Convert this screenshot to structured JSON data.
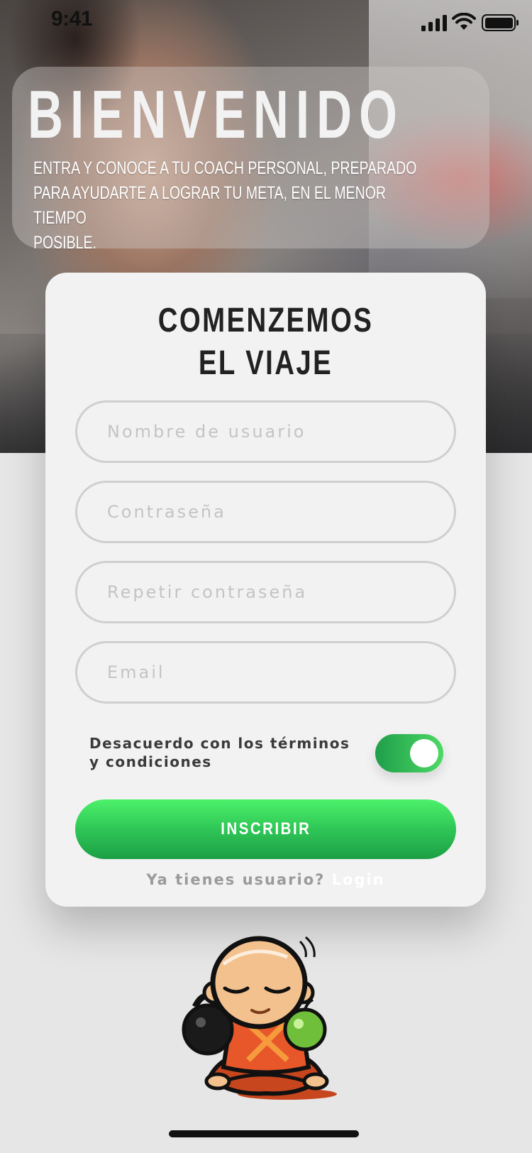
{
  "status_bar": {
    "time": "9:41"
  },
  "welcome": {
    "title": "BIENVENIDO",
    "subtitle_lines": [
      "ENTRA Y CONOCE A TU COACH PERSONAL, PREPARADO",
      "PARA AYUDARTE A LOGRAR TU META, EN EL MENOR TIEMPO",
      "POSIBLE."
    ]
  },
  "form": {
    "title_lines": [
      "COMENZEMOS",
      "EL VIAJE"
    ],
    "fields": {
      "username": {
        "placeholder": "Nombre de usuario",
        "value": ""
      },
      "password": {
        "placeholder": "Contraseña",
        "value": ""
      },
      "repeat_password": {
        "placeholder": "Repetir contraseña",
        "value": ""
      },
      "email": {
        "placeholder": "Email",
        "value": ""
      }
    },
    "terms_lines": [
      "Desacuerdo con los términos",
      "y condiciones"
    ],
    "terms_toggle_on": true,
    "submit_label": "INSCRIBIR",
    "login_prompt": "Ya tienes usuario?",
    "login_link": "Login"
  },
  "colors": {
    "accent_green": "#2fc656",
    "card_background": "#f2f2f2",
    "page_background": "#e6e6e6"
  },
  "icons": [
    "signal-icon",
    "wifi-icon",
    "battery-icon",
    "mascot-monk-logo"
  ]
}
